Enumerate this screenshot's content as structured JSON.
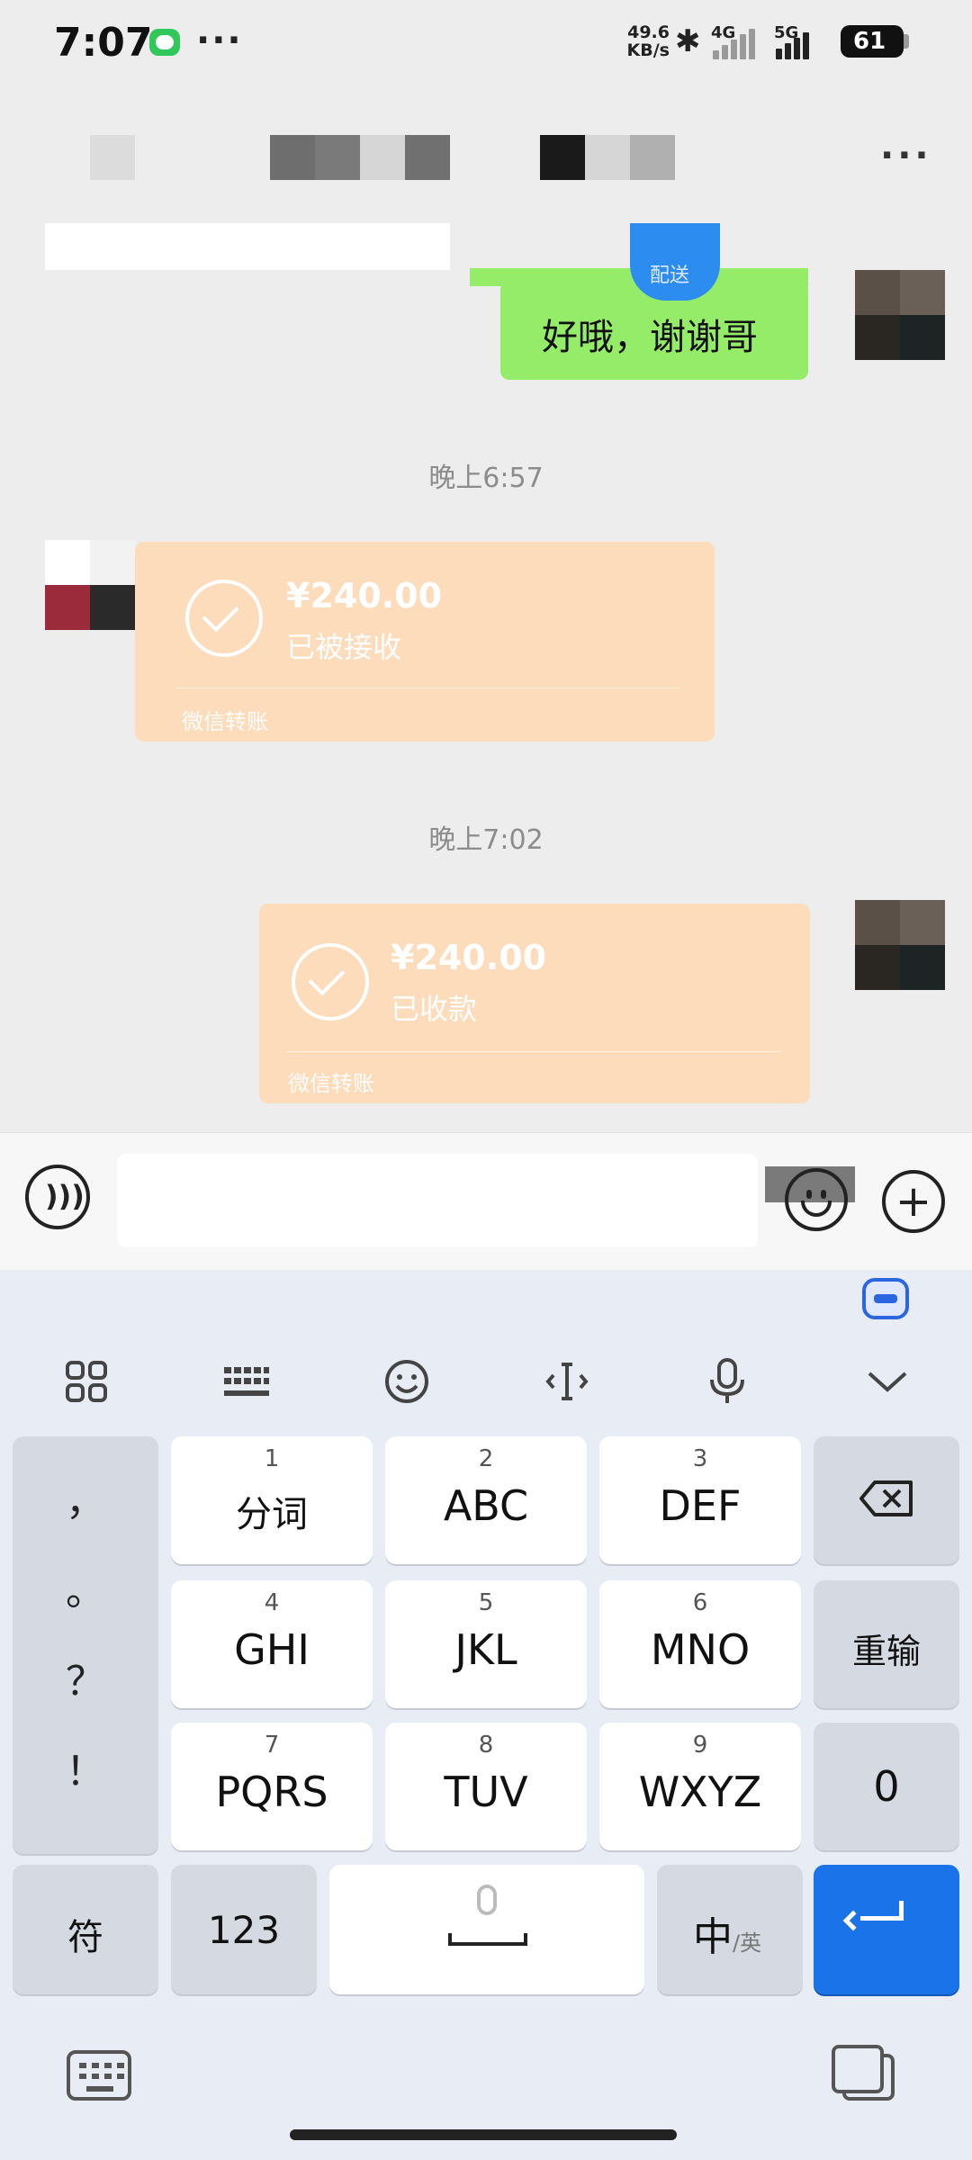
{
  "status_bar": {
    "time": "7:07",
    "network_speed_value": "49.6",
    "network_speed_unit": "KB/s",
    "network_4g": "4G",
    "network_5g": "5G",
    "battery": "61"
  },
  "chat": {
    "green_bubble_text": "好哦，谢谢哥",
    "badge_text": "配送",
    "timestamps": [
      "晚上6:57",
      "晚上7:02"
    ],
    "transfers": [
      {
        "amount": "¥240.00",
        "status": "已被接收",
        "label": "微信转账"
      },
      {
        "amount": "¥240.00",
        "status": "已收款",
        "label": "微信转账"
      }
    ]
  },
  "input_bar": {
    "text_value": ""
  },
  "keyboard": {
    "punctuation": [
      "，",
      "。",
      "？",
      "！"
    ],
    "keys": [
      {
        "num": "1",
        "label": "分词"
      },
      {
        "num": "2",
        "label": "ABC"
      },
      {
        "num": "3",
        "label": "DEF"
      },
      {
        "num": "4",
        "label": "GHI"
      },
      {
        "num": "5",
        "label": "JKL"
      },
      {
        "num": "6",
        "label": "MNO"
      },
      {
        "num": "7",
        "label": "PQRS"
      },
      {
        "num": "8",
        "label": "TUV"
      },
      {
        "num": "9",
        "label": "WXYZ"
      }
    ],
    "reenter": "重输",
    "zero": "0",
    "symbol": "符",
    "numbers": "123",
    "lang_main": "中",
    "lang_alt": "/英"
  },
  "colors": {
    "green_bubble": "#95ec69",
    "transfer_card": "#fddcbb",
    "enter_key": "#1a73e8"
  },
  "icons": {
    "toolbar": [
      "grid-icon",
      "keyboard-icon",
      "emoji-icon",
      "cursor-icon",
      "mic-icon",
      "chevron-down-icon"
    ]
  }
}
